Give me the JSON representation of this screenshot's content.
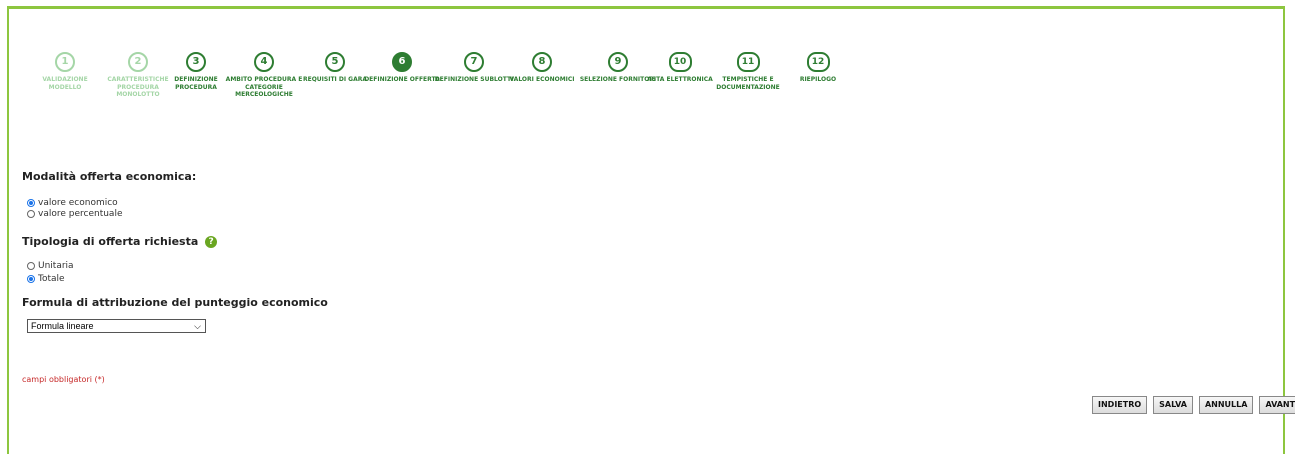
{
  "wizard": {
    "steps": [
      {
        "num": "1",
        "label": "Validazione modello",
        "state": "done"
      },
      {
        "num": "2",
        "label": "Caratteristiche procedura monolotto",
        "state": "done"
      },
      {
        "num": "3",
        "label": "Definizione procedura",
        "state": "todo"
      },
      {
        "num": "4",
        "label": "Ambito procedura e categorie merceologiche",
        "state": "todo"
      },
      {
        "num": "5",
        "label": "Requisiti di gara",
        "state": "todo"
      },
      {
        "num": "6",
        "label": "Definizione offerta",
        "state": "active"
      },
      {
        "num": "7",
        "label": "Definizione sublotti",
        "state": "todo"
      },
      {
        "num": "8",
        "label": "Valori economici",
        "state": "todo"
      },
      {
        "num": "9",
        "label": "Selezione fornitori",
        "state": "todo"
      },
      {
        "num": "10",
        "label": "Asta elettronica",
        "state": "todo"
      },
      {
        "num": "11",
        "label": "Tempistiche e documentazione",
        "state": "todo"
      },
      {
        "num": "12",
        "label": "Riepilogo",
        "state": "todo"
      }
    ]
  },
  "form": {
    "modalita_title": "Modalità offerta economica:",
    "modalita_options": [
      "valore economico",
      "valore percentuale"
    ],
    "tipologia_title": "Tipologia di offerta richiesta",
    "tipologia_help": "?",
    "tipologia_options": [
      "Unitaria",
      "Totale"
    ],
    "formula_title": "Formula di attribuzione del punteggio economico",
    "formula_selected": "Formula lineare",
    "required_note": "campi obbligatori (*)"
  },
  "buttons": {
    "back": "INDIETRO",
    "save": "SALVA",
    "cancel": "ANNULLA",
    "next": "AVANTI"
  },
  "colors": {
    "accent": "#2e7d32",
    "frame": "#8dc63f",
    "required": "#c62828"
  }
}
